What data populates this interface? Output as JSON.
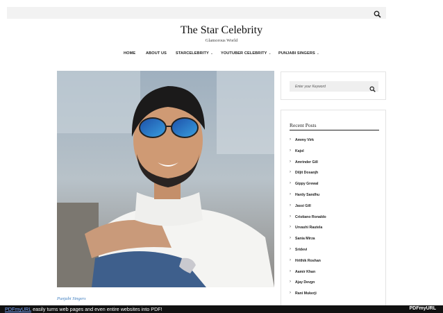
{
  "header": {
    "search_icon": "search-icon",
    "site_title": "The Star Celebrity",
    "tagline": "Glamorous World"
  },
  "nav": {
    "items": [
      {
        "label": "HOME",
        "has_dropdown": false
      },
      {
        "label": "ABOUT US",
        "has_dropdown": false
      },
      {
        "label": "STARCELEBRITY",
        "has_dropdown": true
      },
      {
        "label": "YOUTUBER CELEBRITY",
        "has_dropdown": true
      },
      {
        "label": "PUNJABI SINGERS",
        "has_dropdown": true
      }
    ],
    "dropdown_glyph": "⌄"
  },
  "post": {
    "category": "Punjabi Singers"
  },
  "sidebar": {
    "search": {
      "placeholder": "Enter your Keyword",
      "value": ""
    },
    "recent_posts": {
      "title": "Recent Posts",
      "arrow_glyph": "›",
      "items": [
        "Ammy Virk",
        "Kajol",
        "Amrinder Gill",
        "Diljit Dosanjh",
        "Gippy Grewal",
        "Hardy Sandhu",
        "Jassi Gill",
        "Cristiano Ronaldo",
        "Urvashi Rautela",
        "Sania Mirza",
        "Sridevi",
        "Hrithik Roshan",
        "Aamir Khan",
        "Ajay Devgn",
        "Rani Mukerji"
      ]
    }
  },
  "footer": {
    "link_text": "PDFmyURL",
    "message": " easily turns web pages and even entire websites into PDF!",
    "logo": "PDFmyURL"
  },
  "colors": {
    "accent_link": "#3a7bbf",
    "topbar_bg": "#f2f2f2",
    "footer_bg": "#111111"
  }
}
